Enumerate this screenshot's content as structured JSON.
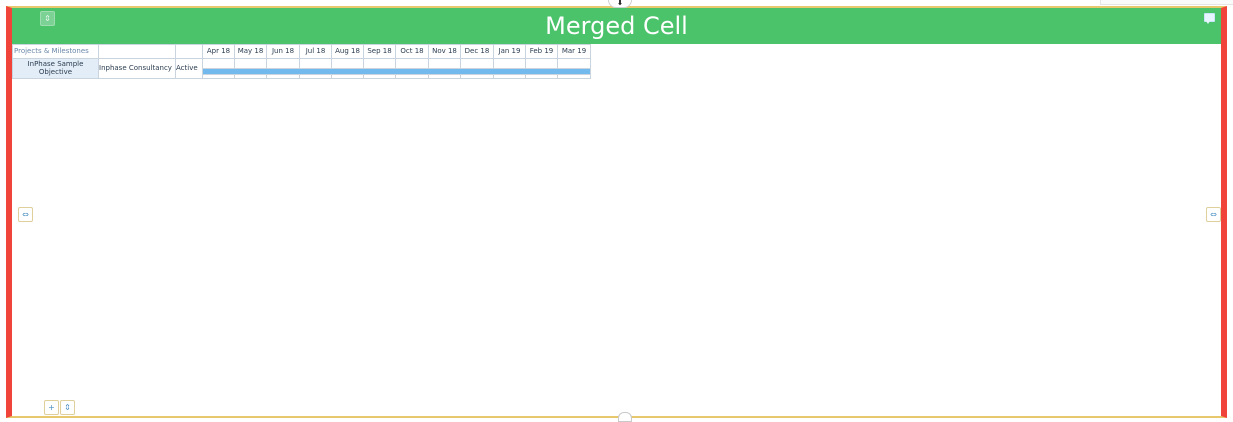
{
  "header": {
    "title": "Merged Cell"
  },
  "grid": {
    "corner_label": "Projects & Milestones",
    "months": [
      "Apr 18",
      "May 18",
      "Jun 18",
      "Jul 18",
      "Aug 18",
      "Sep 18",
      "Oct 18",
      "Nov 18",
      "Dec 18",
      "Jan 19",
      "Feb 19",
      "Mar 19"
    ],
    "row": {
      "objective": "InPhase Sample Objective",
      "owner": "Inphase Consultancy",
      "status": "Active"
    }
  },
  "controls": {
    "add_symbol": "+",
    "move_symbol": "⇕",
    "resize_symbol": "⇔",
    "top_arrow": "⬇"
  },
  "colors": {
    "header_green": "#4bc36b",
    "frame_red": "#f0443a",
    "frame_gold": "#e7c86d",
    "bar_blue": "#72b9ee"
  }
}
